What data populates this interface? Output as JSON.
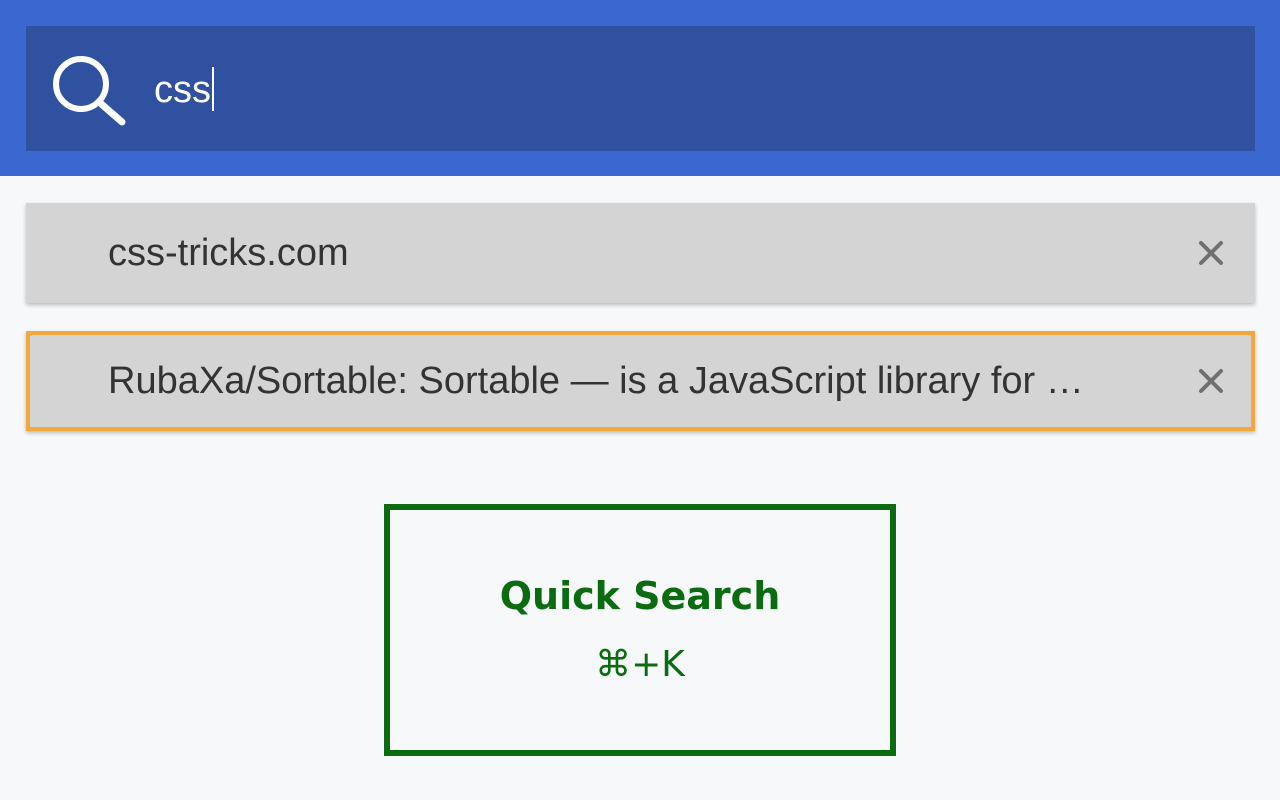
{
  "search": {
    "value": "css",
    "icon": "search-icon"
  },
  "results": [
    {
      "label": "css-tricks.com",
      "close_icon": "close-icon"
    },
    {
      "label": "RubaXa/Sortable: Sortable — is a JavaScript library for …",
      "close_icon": "close-icon",
      "selected": true
    }
  ],
  "shortcut": {
    "title": "Quick Search",
    "keys": "⌘+K"
  },
  "colors": {
    "header_bg": "#3b67d0",
    "search_bg": "#3050a0",
    "result_bg": "#d4d4d4",
    "selected_border": "#f0a93a",
    "shortcut_green": "#0a6b10"
  }
}
